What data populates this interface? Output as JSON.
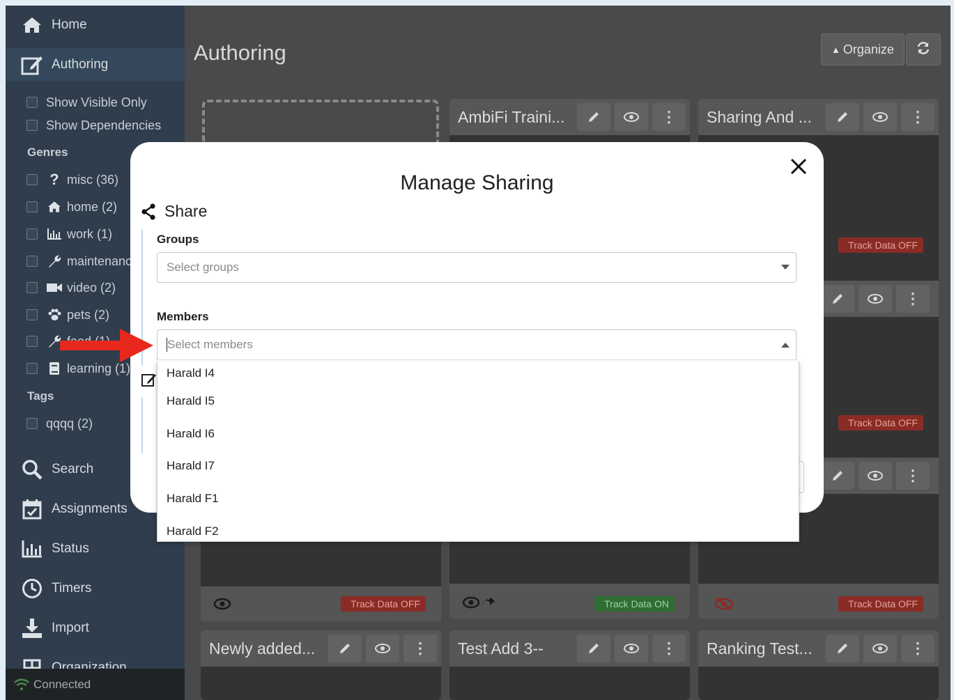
{
  "sidebar": {
    "nav": [
      {
        "label": "Home",
        "icon": "home-icon"
      },
      {
        "label": "Authoring",
        "icon": "edit-icon"
      },
      {
        "label": "Search",
        "icon": "search-icon"
      },
      {
        "label": "Assignments",
        "icon": "calendar-check-icon"
      },
      {
        "label": "Status",
        "icon": "bar-chart-icon"
      },
      {
        "label": "Timers",
        "icon": "clock-icon"
      },
      {
        "label": "Import",
        "icon": "download-icon"
      },
      {
        "label": "Organization",
        "icon": "grid-icon"
      }
    ],
    "filters": [
      {
        "label": "Show Visible Only"
      },
      {
        "label": "Show Dependencies"
      }
    ],
    "genres_label": "Genres",
    "genres": [
      {
        "label": "misc (36)",
        "icon": "question-icon"
      },
      {
        "label": "home (2)",
        "icon": "home-icon"
      },
      {
        "label": "work (1)",
        "icon": "bar-chart-icon"
      },
      {
        "label": "maintenance",
        "icon": "wrench-icon"
      },
      {
        "label": "video (2)",
        "icon": "video-camera-icon"
      },
      {
        "label": "pets (2)",
        "icon": "paw-icon"
      },
      {
        "label": "food (1)",
        "icon": "utensils-icon"
      },
      {
        "label": "learning (1)",
        "icon": "book-icon"
      }
    ],
    "tags_label": "Tags",
    "tags": [
      {
        "label": "qqqq (2)"
      }
    ],
    "status": "Connected"
  },
  "main": {
    "title": "Authoring",
    "organize_label": "Organize"
  },
  "cards": [
    {
      "title": "AmbiFi Traini...",
      "track": "Track Data ON"
    },
    {
      "title": "Sharing And ...",
      "track": "Track Data OFF"
    },
    {
      "track": "Track Data OFF"
    },
    {
      "track": "Track Data OFF"
    },
    {
      "track": "Track Data OFF"
    },
    {
      "title": "Newly added..."
    },
    {
      "title": "Test Add 3--"
    },
    {
      "title": "Ranking Test..."
    }
  ],
  "modal": {
    "title": "Manage Sharing",
    "share_label": "Share",
    "groups_label": "Groups",
    "groups_placeholder": "Select groups",
    "members_label": "Members",
    "members_placeholder": "Select members",
    "members_options": [
      "Harald I4",
      "Harald I5",
      "Harald I6",
      "Harald I7",
      "Harald F1",
      "Harald F2"
    ]
  },
  "colors": {
    "annotation_arrow": "#e8281c",
    "track_off": "#c0392b",
    "track_on": "#3c9a43"
  }
}
